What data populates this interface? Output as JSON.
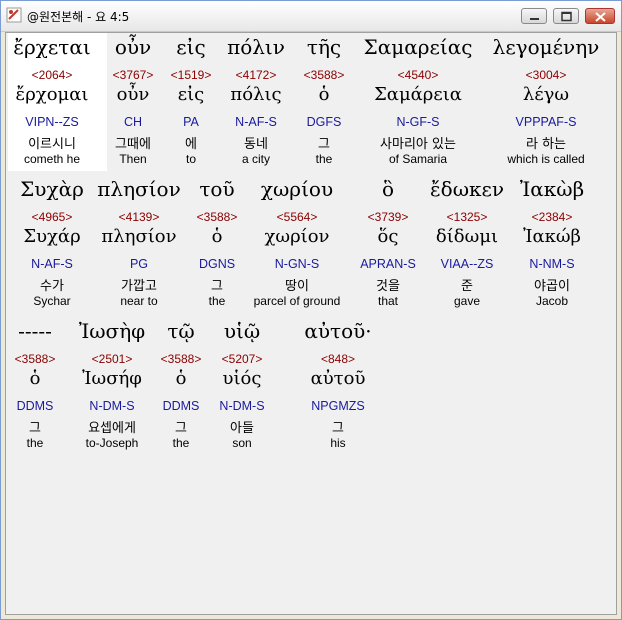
{
  "window": {
    "title": "@원전본해 - 요 4:5",
    "buttons": {
      "minimize": "minimize-icon",
      "maximize": "maximize-icon",
      "close": "close-icon"
    }
  },
  "rows": [
    [
      {
        "greek": "ἔρχεται",
        "strong": "<2064>",
        "lemma": "ἔρχομαι",
        "parse": "VIPN--ZS",
        "korean": "이르시니",
        "english": "cometh he"
      },
      {
        "greek": "οὖν",
        "strong": "<3767>",
        "lemma": "οὖν",
        "parse": "CH",
        "korean": "그때에",
        "english": "Then"
      },
      {
        "greek": "εἰς",
        "strong": "<1519>",
        "lemma": "εἰς",
        "parse": "PA",
        "korean": "에",
        "english": "to"
      },
      {
        "greek": "πόλιν",
        "strong": "<4172>",
        "lemma": "πόλις",
        "parse": "N-AF-S",
        "korean": "동네",
        "english": "a city"
      },
      {
        "greek": "τῆς",
        "strong": "<3588>",
        "lemma": "ὁ",
        "parse": "DGFS",
        "korean": "그",
        "english": "the"
      },
      {
        "greek": "Σαμαρείας",
        "strong": "<4540>",
        "lemma": "Σαμάρεια",
        "parse": "N-GF-S",
        "korean": "사마리아 있는",
        "english": "of Samaria"
      },
      {
        "greek": "λεγομένην",
        "strong": "<3004>",
        "lemma": "λέγω",
        "parse": "VPPPAF-S",
        "korean": "라 하는",
        "english": "which is called"
      }
    ],
    [
      {
        "greek": "Συχὰρ",
        "strong": "<4965>",
        "lemma": "Συχάρ",
        "parse": "N-AF-S",
        "korean": "수가",
        "english": "Sychar"
      },
      {
        "greek": "πλησίον",
        "strong": "<4139>",
        "lemma": "πλησίον",
        "parse": "PG",
        "korean": "가깝고",
        "english": "near to"
      },
      {
        "greek": "τοῦ",
        "strong": "<3588>",
        "lemma": "ὁ",
        "parse": "DGNS",
        "korean": "그",
        "english": "the"
      },
      {
        "greek": "χωρίου",
        "strong": "<5564>",
        "lemma": "χωρίον",
        "parse": "N-GN-S",
        "korean": "땅이",
        "english": "parcel of ground"
      },
      {
        "greek": "ὃ",
        "strong": "<3739>",
        "lemma": "ὅς",
        "parse": "APRAN-S",
        "korean": "것을",
        "english": "that"
      },
      {
        "greek": "ἔδωκεν",
        "strong": "<1325>",
        "lemma": "δίδωμι",
        "parse": "VIAA--ZS",
        "korean": "준",
        "english": "gave"
      },
      {
        "greek": "Ἰακὼβ",
        "strong": "<2384>",
        "lemma": "Ἰακώβ",
        "parse": "N-NM-S",
        "korean": "야곱이",
        "english": "Jacob"
      }
    ],
    [
      {
        "greek": "-----",
        "strong": "<3588>",
        "lemma": "ὁ",
        "parse": "DDMS",
        "korean": "그",
        "english": "the"
      },
      {
        "greek": "Ἰωσὴφ",
        "strong": "<2501>",
        "lemma": "Ἰωσήφ",
        "parse": "N-DM-S",
        "korean": "요셉에게",
        "english": "to-Joseph"
      },
      {
        "greek": "τῷ",
        "strong": "<3588>",
        "lemma": "ὁ",
        "parse": "DDMS",
        "korean": "그",
        "english": "the"
      },
      {
        "greek": "υἱῷ",
        "strong": "<5207>",
        "lemma": "υἱός",
        "parse": "N-DM-S",
        "korean": "아들",
        "english": "son"
      },
      {
        "greek": "αὐτοῦ·",
        "strong": "<848>",
        "lemma": "αὐτοῦ",
        "parse": "NPGMZS",
        "korean": "그",
        "english": "his"
      }
    ]
  ]
}
